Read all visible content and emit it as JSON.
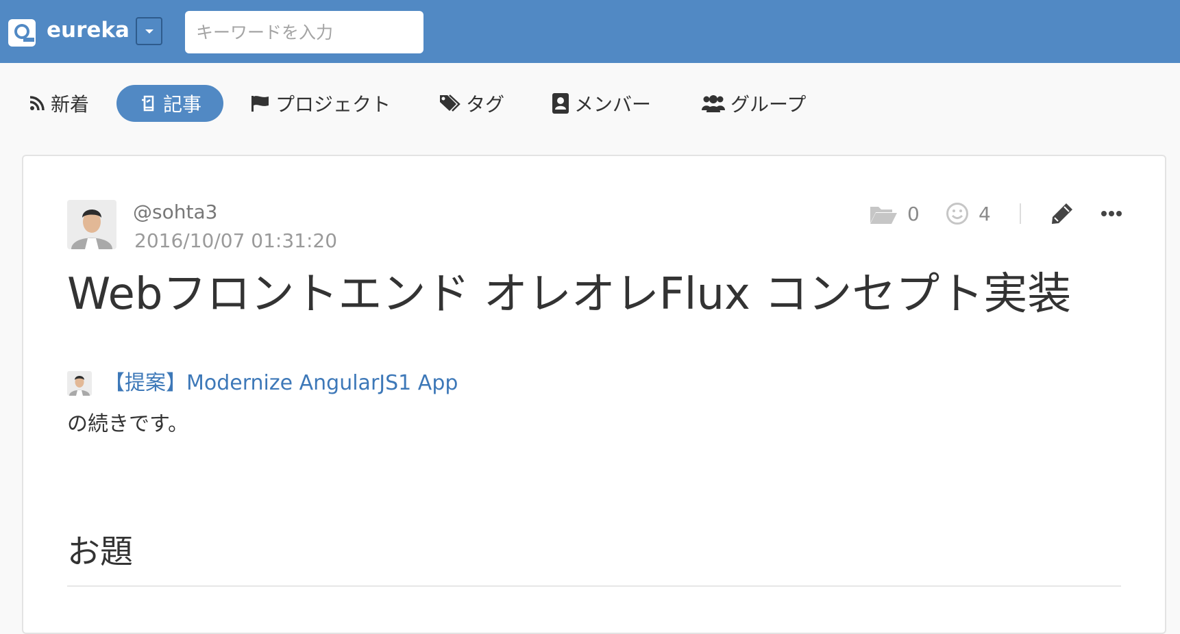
{
  "header": {
    "brand": "eureka",
    "search_placeholder": "キーワードを入力"
  },
  "nav": {
    "items": [
      {
        "label": "新着",
        "icon": "rss-icon"
      },
      {
        "label": "記事",
        "icon": "documents-icon",
        "active": true
      },
      {
        "label": "プロジェクト",
        "icon": "flag-icon"
      },
      {
        "label": "タグ",
        "icon": "tags-icon"
      },
      {
        "label": "メンバー",
        "icon": "address-book-icon"
      },
      {
        "label": "グループ",
        "icon": "users-icon"
      }
    ]
  },
  "article": {
    "author": "@sohta3",
    "timestamp": "2016/10/07 01:31:20",
    "folder_count": "0",
    "reaction_count": "4",
    "title": "Webフロントエンド オレオレFlux コンセプト実装",
    "reference_link": "【提案】Modernize AngularJS1 App",
    "body_text": "の続きです。",
    "section_heading": "お題"
  },
  "colors": {
    "header_bg": "#5189c4",
    "link": "#3d78b8",
    "page_bg": "#f9f9f9"
  }
}
